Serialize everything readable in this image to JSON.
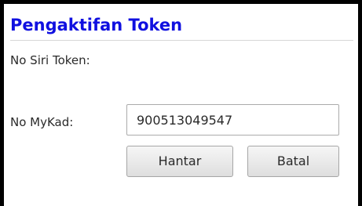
{
  "form": {
    "title": "Pengaktifan Token",
    "token_serial_label": "No Siri Token:",
    "mykad_label": "No MyKad:",
    "mykad_value": "900513049547"
  },
  "actions": {
    "submit_label": "Hantar",
    "cancel_label": "Batal"
  },
  "colors": {
    "title": "#1010e0",
    "frame_border": "#000000"
  }
}
